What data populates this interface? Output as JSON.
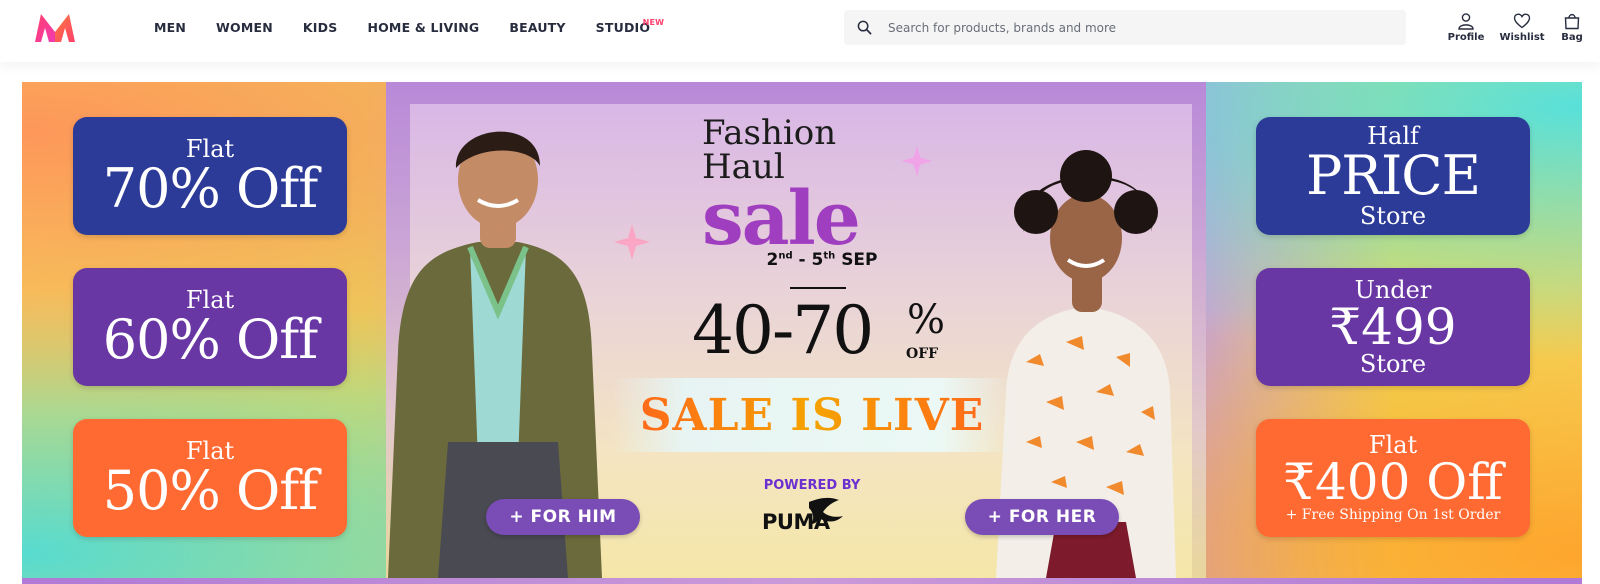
{
  "header": {
    "nav": [
      {
        "label": "MEN"
      },
      {
        "label": "WOMEN"
      },
      {
        "label": "KIDS"
      },
      {
        "label": "HOME & LIVING"
      },
      {
        "label": "BEAUTY"
      },
      {
        "label": "STUDIO",
        "tag": "NEW"
      }
    ],
    "search": {
      "placeholder": "Search for products, brands and more",
      "value": ""
    },
    "actions": [
      {
        "label": "Profile",
        "icon": "profile-icon"
      },
      {
        "label": "Wishlist",
        "icon": "heart-icon"
      },
      {
        "label": "Bag",
        "icon": "bag-icon"
      }
    ]
  },
  "banner": {
    "left_promos": [
      {
        "line1": "Flat",
        "line2": "70% Off",
        "color": "#2c3a98"
      },
      {
        "line1": "Flat",
        "line2": "60% Off",
        "color": "#6837a4"
      },
      {
        "line1": "Flat",
        "line2": "50% Off",
        "color": "#ff6a33"
      }
    ],
    "right_promos": [
      {
        "line1": "Half",
        "line2": "PRICE",
        "line3": "Store",
        "color": "#2c3a98"
      },
      {
        "line1": "Under",
        "line2": "₹499",
        "line3": "Store",
        "color": "#6837a4"
      },
      {
        "line1": "Flat",
        "line2": "₹400 Off",
        "line3": "+ Free Shipping On 1st Order",
        "color": "#ff6a33"
      }
    ],
    "headline": {
      "line1": "Fashion",
      "line2": "Haul",
      "line3": "sale"
    },
    "dates": {
      "start_day": "2",
      "start_suffix": "nd",
      "separator": " - ",
      "end_day": "5",
      "end_suffix": "th",
      "month": "SEP"
    },
    "discount": {
      "range": "40-70",
      "percent": "%",
      "off": "OFF"
    },
    "live_text": "SALE IS LIVE",
    "powered_by": "POWERED BY",
    "brand": "PUMA",
    "cta_him": "+ FOR HIM",
    "cta_her": "+ FOR HER"
  },
  "colors": {
    "brand_pink": "#ff3f6c",
    "sale_purple": "#a03ec0",
    "live_orange": "#ff6a1a",
    "cta_purple": "#7a4cb6"
  }
}
